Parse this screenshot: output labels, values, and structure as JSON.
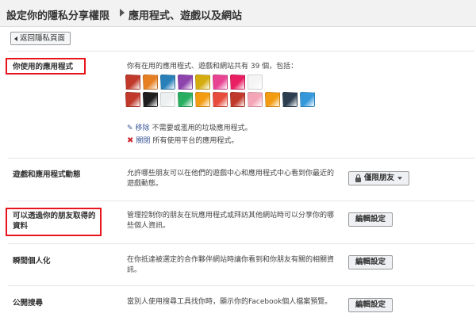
{
  "header": {
    "title": "設定你的隱私分享權限",
    "subtitle": "應用程式、遊戲以及網站"
  },
  "back_button": {
    "label": "返回隱私頁面"
  },
  "sections": {
    "apps": {
      "title": "你使用的應用程式",
      "summary": "你有在用的應用程式、遊戲和網站共有 39 個，包括：",
      "remove_link": "移除",
      "remove_text": "不需要或濫用的垃圾應用程式。",
      "disable_link": "關閉",
      "disable_text": "所有使用平台的應用程式。",
      "icons": [
        [
          "#c0392b",
          "#e67e22",
          "#2980b9",
          "#8e44ad",
          "#d4ac0d",
          "#e84393",
          "#e91e63",
          "#f5f5f5"
        ],
        [
          "#c0392b",
          "#1e1e1e",
          "#ecf0f1",
          "#27ae60",
          "#f39c12",
          "#e74c3c",
          "#c0392b",
          "#f4a6b7",
          "#f39c12",
          "#2c3e50",
          "#3498db"
        ]
      ]
    },
    "game_activity": {
      "title": "遊戲和應用程式動態",
      "desc": "允許哪些朋友可以在他們的遊戲中心和應用程式中心看到你最近的遊戲動態。",
      "button": "僅限朋友"
    },
    "friends_info": {
      "title_line1": "可以透過你的朋友取得的",
      "title_line2": "資料",
      "desc": "管理控制你的朋友在玩應用程式或拜訪其他網站時可以分享你的哪些個人資訊。",
      "button": "編輯設定"
    },
    "instant_personalization": {
      "title": "瞬間個人化",
      "desc": "在你抵達被選定的合作夥伴網站時讓你看到和你朋友有關的相關資訊。",
      "button": "編輯設定"
    },
    "public_search": {
      "title": "公開搜尋",
      "desc": "當別人使用搜尋工具找你時，顯示你的Facebook個人檔案預覽。",
      "button": "編輯設定"
    }
  }
}
